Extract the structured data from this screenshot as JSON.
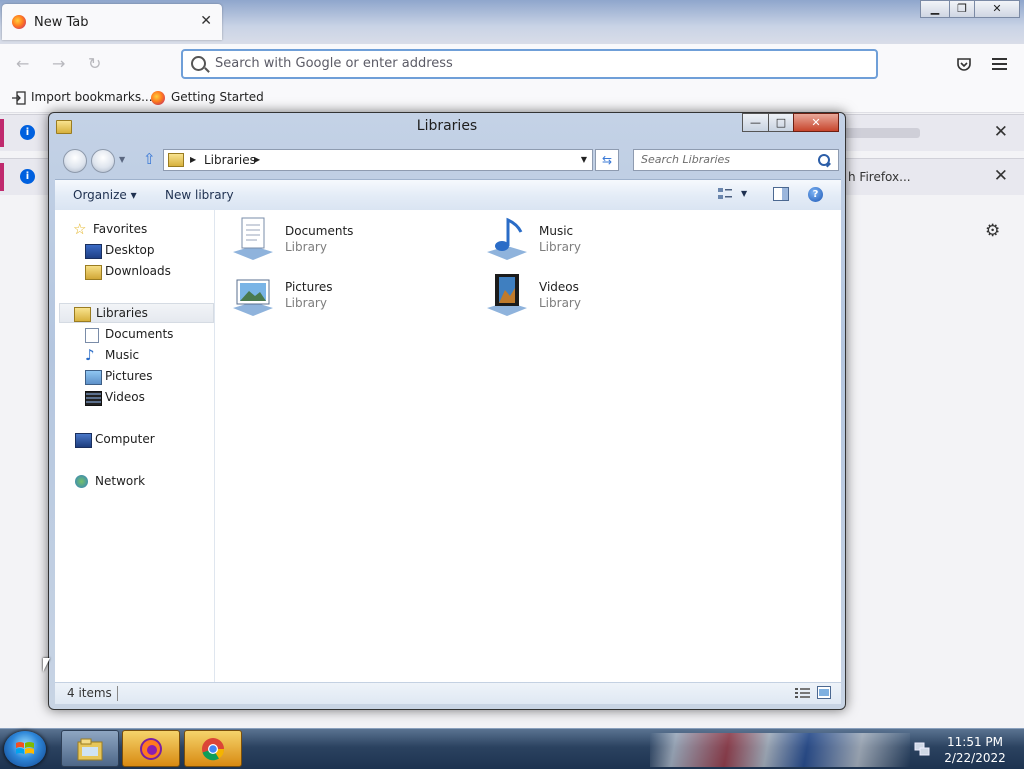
{
  "firefox": {
    "tab_title": "New Tab",
    "tab_close": "✕",
    "url_placeholder": "Search with Google or enter address",
    "bookmarks": [
      "Import bookmarks...",
      "Getting Started"
    ],
    "notification_fragment": "h Firefox..."
  },
  "explorer": {
    "title": "Libraries",
    "caption_minimize": "—",
    "caption_maximize": "□",
    "caption_close": "✕",
    "breadcrumb": "Libraries",
    "search_placeholder": "Search Libraries",
    "commands": {
      "organize": "Organize ▾",
      "new_library": "New library"
    },
    "nav": {
      "favorites": "Favorites",
      "favorite_items": [
        "Desktop",
        "Downloads"
      ],
      "libraries": "Libraries",
      "library_items": [
        "Documents",
        "Music",
        "Pictures",
        "Videos"
      ],
      "computer": "Computer",
      "network": "Network"
    },
    "libraries": [
      {
        "name": "Documents",
        "type": "Library",
        "icon": "documents-library-icon"
      },
      {
        "name": "Music",
        "type": "Library",
        "icon": "music-library-icon"
      },
      {
        "name": "Pictures",
        "type": "Library",
        "icon": "pictures-library-icon"
      },
      {
        "name": "Videos",
        "type": "Library",
        "icon": "videos-library-icon"
      }
    ],
    "status_count": "4 items"
  },
  "taskbar": {
    "apps": [
      "windows-explorer",
      "firefox",
      "chrome"
    ],
    "clock_time": "11:51 PM",
    "clock_date": "2/22/2022"
  },
  "colors": {
    "accent": "#3a79d6",
    "firefox_info": "#0060df",
    "explorer_close": "#c7452c"
  }
}
